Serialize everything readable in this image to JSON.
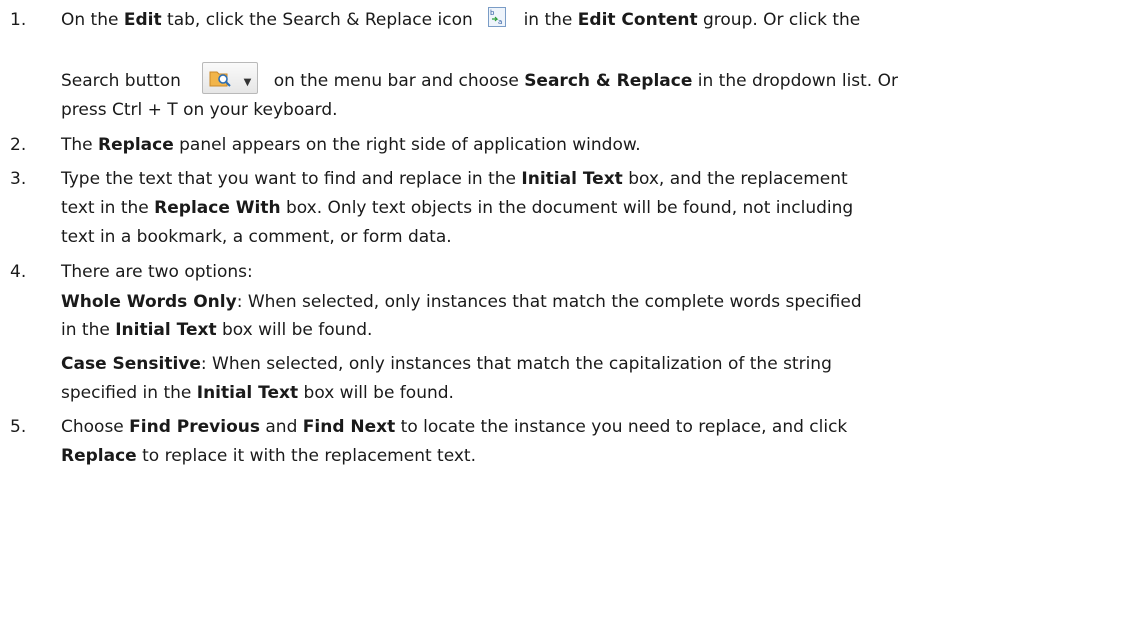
{
  "steps": [
    {
      "number": "1.",
      "line1": {
        "a": "On the ",
        "b": "Edit",
        "c": " tab, click the Search & Replace icon ",
        "d": " in the ",
        "e": "Edit Content",
        "f": " group. Or click the"
      },
      "line2": {
        "a": "Search button ",
        "b": " on the menu bar and choose ",
        "c": "Search & Replace",
        "d": " in the dropdown list. Or"
      },
      "line3": "press Ctrl + T on your keyboard.",
      "icons": {
        "inline_icon": "search-replace-icon",
        "button_icon": "search-button-icon"
      }
    },
    {
      "number": "2.",
      "a": "The ",
      "b": "Replace",
      "c": " panel appears on the right side of application window."
    },
    {
      "number": "3.",
      "line1": {
        "a": "Type the text that you want to find and replace in the ",
        "b": "Initial Text",
        "c": " box, and the replacement"
      },
      "line2": {
        "a": "text in the ",
        "b": "Replace With",
        "c": " box. Only text objects in the document will be found, not including"
      },
      "line3": "text in a bookmark, a comment, or form data."
    },
    {
      "number": "4.",
      "intro": "There are two options:",
      "opt1_line1": {
        "a": "Whole Words Only",
        "b": ": When selected, only instances that match the complete words specified"
      },
      "opt1_line2": {
        "a": "in the ",
        "b": "Initial Text",
        "c": " box will be found."
      },
      "opt2_line1": {
        "a": "Case Sensitive",
        "b": ": When selected, only instances that match the capitalization of the string"
      },
      "opt2_line2": {
        "a": "specified in the ",
        "b": "Initial Text",
        "c": " box will be found."
      }
    },
    {
      "number": "5.",
      "line1": {
        "a": "Choose ",
        "b": "Find Previous",
        "c": " and ",
        "d": "Find Next",
        "e": " to locate the instance you need to replace, and click"
      },
      "line2": {
        "a": "Replace",
        "b": " to replace it with the replacement text."
      }
    }
  ]
}
